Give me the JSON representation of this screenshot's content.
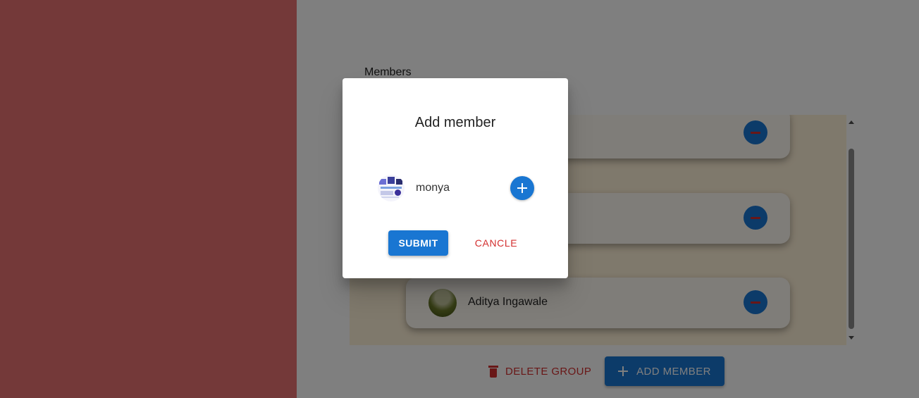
{
  "page": {
    "members_label": "Members",
    "members": [
      {
        "name": ""
      },
      {
        "name": ""
      },
      {
        "name": "Aditya Ingawale",
        "avatar": "avatar-image"
      }
    ],
    "delete_group_label": "DELETE GROUP",
    "add_member_label": "ADD MEMBER"
  },
  "dialog": {
    "title": "Add member",
    "candidates": [
      {
        "name": "monya",
        "avatar": "avatar-image"
      }
    ],
    "submit_label": "SUBMIT",
    "cancel_label": "CANCLE"
  },
  "colors": {
    "primary": "#1976d2",
    "danger": "#d32f2f",
    "sidebar": "#e87272",
    "list_background": "#fff2d8"
  }
}
